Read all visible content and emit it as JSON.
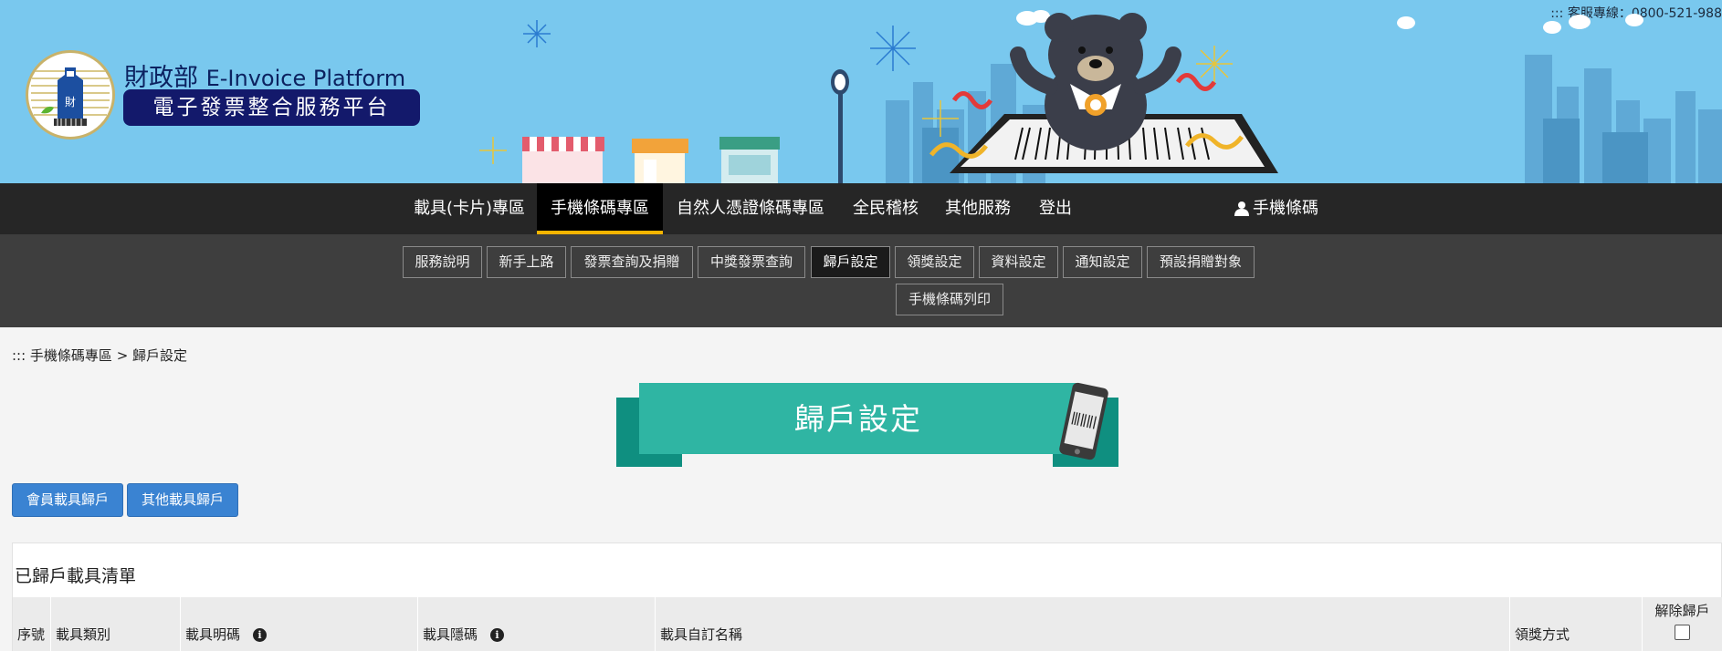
{
  "header": {
    "hotline": "::: 客服專線：0800-521-988",
    "title_zh": "財政部",
    "title_en": "E-Invoice Platform",
    "subtitle": "電子發票整合服務平台",
    "emblem_text": "財政部"
  },
  "mainnav": {
    "items": [
      {
        "label": "載具(卡片)專區"
      },
      {
        "label": "手機條碼專區"
      },
      {
        "label": "自然人憑證條碼專區"
      },
      {
        "label": "全民稽核"
      },
      {
        "label": "其他服務"
      },
      {
        "label": "登出"
      }
    ],
    "active_index": 1,
    "user_label": "手機條碼",
    "accent_color": "#f5b400"
  },
  "subnav": {
    "items": [
      {
        "label": "服務說明"
      },
      {
        "label": "新手上路"
      },
      {
        "label": "發票查詢及捐贈"
      },
      {
        "label": "中獎發票查詢"
      },
      {
        "label": "歸戶設定"
      },
      {
        "label": "領獎設定"
      },
      {
        "label": "資料設定"
      },
      {
        "label": "通知設定"
      },
      {
        "label": "預設捐贈對象"
      },
      {
        "label": "手機條碼列印"
      }
    ],
    "active_index": 4
  },
  "breadcrumb": "::: 手機條碼專區 > 歸戶設定",
  "page_title": "歸戶設定",
  "actions": {
    "member_carrier": "會員載具歸戶",
    "other_carrier": "其他載具歸戶"
  },
  "panel": {
    "title": "已歸戶載具清單",
    "columns": [
      "序號",
      "載具類別",
      "載具明碼",
      "載具隱碼",
      "載具自訂名稱",
      "領獎方式",
      "解除歸戶"
    ]
  },
  "colors": {
    "header_bg": "#79c8ee",
    "nav_bg": "#262626",
    "subnav_bg": "#3e3e3e",
    "ribbon": "#2fb5a3",
    "button": "#3a83d2"
  }
}
